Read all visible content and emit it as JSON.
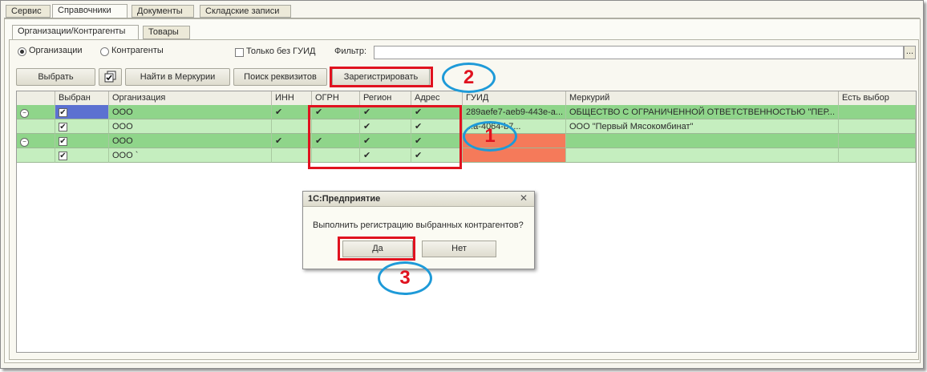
{
  "tabs": [
    "Сервис",
    "Справочники",
    "Документы",
    "Складские записи"
  ],
  "subtabs": [
    "Организации/Контрагенты",
    "Товары"
  ],
  "filter": {
    "radio_org": "Организации",
    "radio_contr": "Контрагенты",
    "only_no_guid": "Только без ГУИД",
    "filter_label": "Фильтр:",
    "filter_value": "",
    "filter_button": "..."
  },
  "toolbar": {
    "select": "Выбрать",
    "find_mercury": "Найти в Меркурии",
    "search_requisites": "Поиск реквизитов",
    "register": "Зарегистрировать"
  },
  "table": {
    "columns": [
      "Выбран",
      "Организация",
      "ИНН",
      "ОГРН",
      "Регион",
      "Адрес",
      "ГУИД",
      "Меркурий",
      "Есть выбор"
    ],
    "rows": [
      {
        "org": "ООО",
        "guid": "289aefe7-aeb9-443e-a...",
        "mercury": "ОБЩЕСТВО С ОГРАНИЧЕННОЙ ОТВЕТСТВЕННОСТЬЮ \"ПЕР..."
      },
      {
        "org": "ООО",
        "guid": "...a-4064-b7...",
        "mercury": "ООО \"Первый Мясокомбинат\""
      },
      {
        "org": "ООО",
        "guid": "",
        "mercury": ""
      },
      {
        "org": "ООО `",
        "guid": "",
        "mercury": ""
      }
    ],
    "check": "✔"
  },
  "dialog": {
    "title": "1С:Предприятие",
    "message": "Выполнить регистрацию выбранных контрагентов?",
    "yes": "Да",
    "no": "Нет",
    "close": "✕"
  },
  "callouts": [
    "1",
    "2",
    "3"
  ],
  "colors": {
    "row_dark": "#8fd58a",
    "row_light": "#c5eebf",
    "guid_red": "#f57a5a",
    "selected_blue": "#5c71d1",
    "annotation_red": "#e0121f",
    "annotation_blue": "#1e9ad8"
  }
}
